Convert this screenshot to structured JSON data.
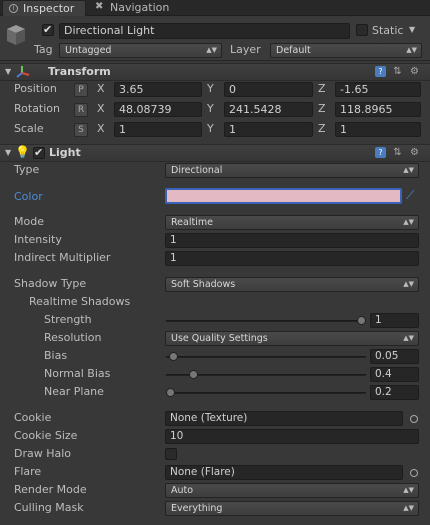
{
  "tabs": [
    {
      "label": "Inspector"
    },
    {
      "label": "Navigation"
    }
  ],
  "object": {
    "name": "Directional Light",
    "static_label": "Static",
    "tag_label": "Tag",
    "tag_value": "Untagged",
    "layer_label": "Layer",
    "layer_value": "Default"
  },
  "transform": {
    "title": "Transform",
    "position": {
      "label": "Position",
      "tag": "P",
      "x": "3.65",
      "y": "0",
      "z": "-1.65"
    },
    "rotation": {
      "label": "Rotation",
      "tag": "R",
      "x": "48.08739",
      "y": "241.5428",
      "z": "118.8965"
    },
    "scale": {
      "label": "Scale",
      "tag": "S",
      "x": "1",
      "y": "1",
      "z": "1"
    },
    "axis_x": "X",
    "axis_y": "Y",
    "axis_z": "Z"
  },
  "light": {
    "title": "Light",
    "type_label": "Type",
    "type_value": "Directional",
    "color_label": "Color",
    "color_value": "#e3b9c4",
    "mode_label": "Mode",
    "mode_value": "Realtime",
    "intensity_label": "Intensity",
    "intensity_value": "1",
    "indirect_label": "Indirect Multiplier",
    "indirect_value": "1",
    "shadow_type_label": "Shadow Type",
    "shadow_type_value": "Soft Shadows",
    "realtime_shadows_label": "Realtime Shadows",
    "strength_label": "Strength",
    "strength_value": "1",
    "resolution_label": "Resolution",
    "resolution_value": "Use Quality Settings",
    "bias_label": "Bias",
    "bias_value": "0.05",
    "normal_bias_label": "Normal Bias",
    "normal_bias_value": "0.4",
    "near_plane_label": "Near Plane",
    "near_plane_value": "0.2",
    "cookie_label": "Cookie",
    "cookie_value": "None (Texture)",
    "cookie_size_label": "Cookie Size",
    "cookie_size_value": "10",
    "draw_halo_label": "Draw Halo",
    "flare_label": "Flare",
    "flare_value": "None (Flare)",
    "render_mode_label": "Render Mode",
    "render_mode_value": "Auto",
    "culling_mask_label": "Culling Mask",
    "culling_mask_value": "Everything"
  }
}
